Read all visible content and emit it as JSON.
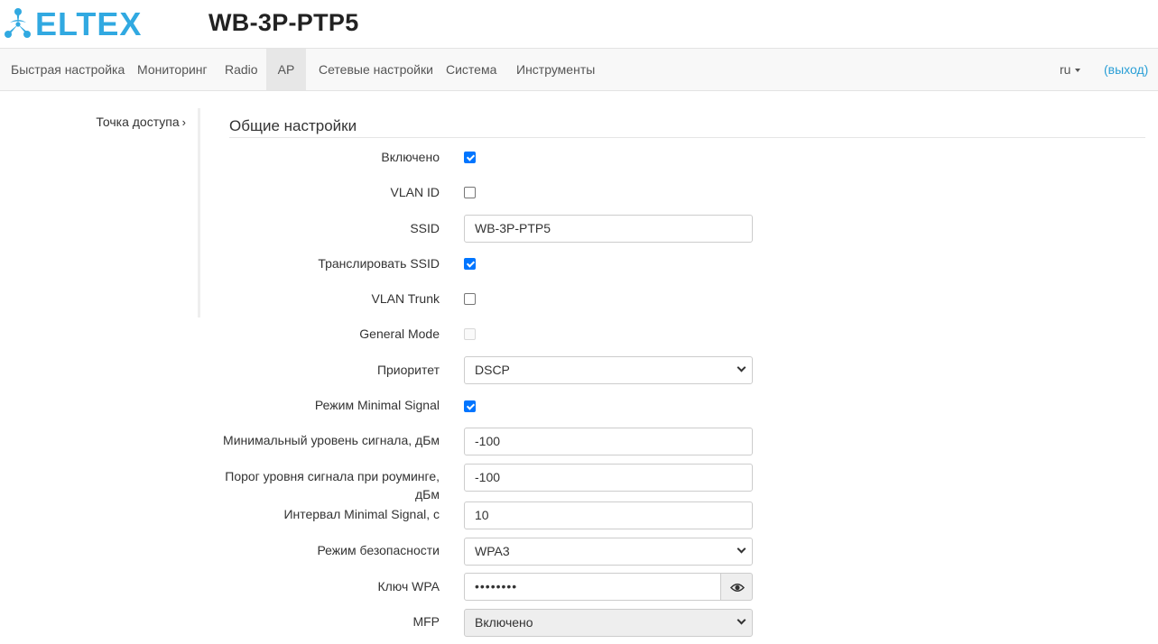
{
  "header": {
    "brand": "ELTEX",
    "device_title": "WB-3P-PTP5"
  },
  "navbar": {
    "items": [
      {
        "label": "Быстрая настройка"
      },
      {
        "label": "Мониторинг"
      },
      {
        "label": "Radio"
      },
      {
        "label": "AP"
      },
      {
        "label": "Сетевые настройки"
      },
      {
        "label": "Система"
      },
      {
        "label": "Инструменты"
      }
    ],
    "active": "AP",
    "lang": "ru",
    "logout": "(выход)"
  },
  "sidebar": {
    "items": [
      {
        "label": "Точка доступа"
      }
    ]
  },
  "section": {
    "title": "Общие настройки"
  },
  "form": {
    "enabled": {
      "label": "Включено",
      "checked": true
    },
    "vlan_id": {
      "label": "VLAN ID",
      "checked": false
    },
    "ssid": {
      "label": "SSID",
      "value": "WB-3P-PTP5"
    },
    "broadcast_ssid": {
      "label": "Транслировать SSID",
      "checked": true
    },
    "vlan_trunk": {
      "label": "VLAN Trunk",
      "checked": false
    },
    "general_mode": {
      "label": "General Mode",
      "checked": false,
      "disabled": true
    },
    "priority": {
      "label": "Приоритет",
      "value": "DSCP"
    },
    "minimal_signal_mode": {
      "label": "Режим Minimal Signal",
      "checked": true
    },
    "min_signal_level": {
      "label": "Минимальный уровень сигнала, дБм",
      "value": "-100"
    },
    "roaming_threshold": {
      "label_line1": "Порог уровня сигнала при роуминге,",
      "label_line2": "дБм",
      "value": "-100"
    },
    "minimal_signal_interval": {
      "label": "Интервал Minimal Signal, с",
      "value": "10"
    },
    "security_mode": {
      "label": "Режим безопасности",
      "value": "WPA3"
    },
    "wpa_key": {
      "label": "Ключ WPA",
      "value": "••••••••"
    },
    "mfp": {
      "label": "MFP",
      "value": "Включено"
    }
  },
  "colors": {
    "accent": "#2a9fd6",
    "logo": "#31a9e1",
    "checkbox": "#0075ff"
  }
}
